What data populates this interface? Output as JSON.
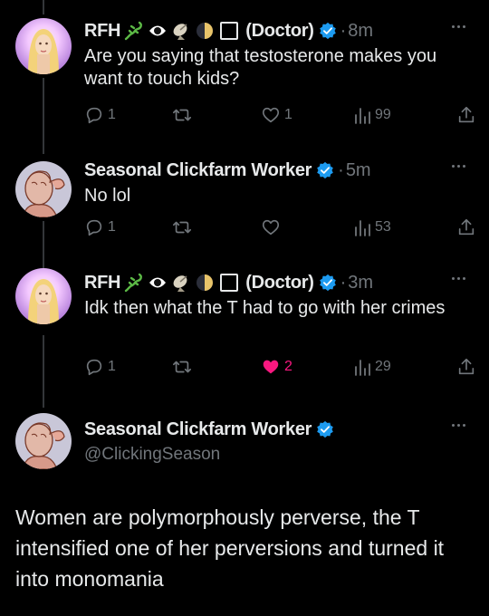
{
  "tweets": [
    {
      "name": "RFH",
      "emojis": [
        "lizard",
        "eye-in-speech-bubble",
        "satellite-dish",
        "first-quarter-moon",
        "black-square"
      ],
      "title_suffix": "(Doctor)",
      "separator": "·",
      "time": "8m",
      "text": "Are you saying that testosterone makes you want to touch kids?",
      "replies": "1",
      "retweets": "",
      "likes": "1",
      "views": "99",
      "liked": false
    },
    {
      "name": "Seasonal Clickfarm Worker",
      "separator": "·",
      "time": "5m",
      "text": "No lol",
      "replies": "1",
      "retweets": "",
      "likes": "",
      "views": "53",
      "liked": false
    },
    {
      "name": "RFH",
      "emojis": [
        "lizard",
        "eye-in-speech-bubble",
        "satellite-dish",
        "first-quarter-moon",
        "black-square"
      ],
      "title_suffix": "(Doctor)",
      "separator": "·",
      "time": "3m",
      "text": "Idk then what the T had to go with her crimes",
      "replies": "1",
      "retweets": "",
      "likes": "2",
      "views": "29",
      "liked": true
    }
  ],
  "main_tweet": {
    "name": "Seasonal Clickfarm Worker",
    "handle": "@ClickingSeason",
    "text": "Women are polymorphously perverse, the T intensified one of her perversions and turned it into monomania"
  },
  "colors": {
    "background": "#000000",
    "text": "#e7e9ea",
    "muted": "#71767b",
    "verified": "#1d9bf0",
    "like_active": "#f91880"
  }
}
